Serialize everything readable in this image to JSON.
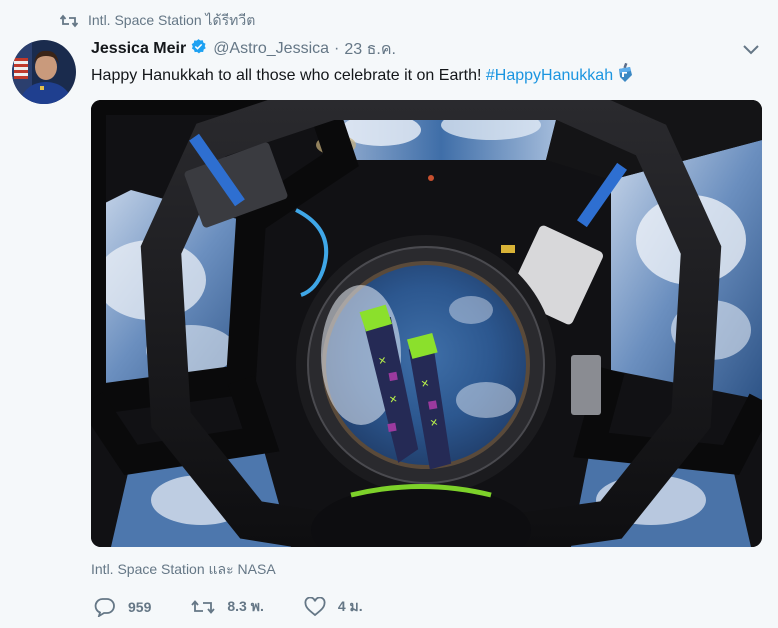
{
  "retweet": {
    "icon": "retweet-icon",
    "text": "Intl. Space Station ได้รีทวีต"
  },
  "author": {
    "display_name": "Jessica Meir",
    "handle": "@Astro_Jessica",
    "separator": "·",
    "time": "23 ธ.ค.",
    "verified": true
  },
  "tweet": {
    "text": "Happy Hanukkah to all those who celebrate it on Earth! ",
    "hashtag": "#HappyHanukkah",
    "emoji": "dreidel-emoji"
  },
  "media": {
    "description_icon": "photo"
  },
  "tagged": "Intl. Space Station และ NASA",
  "actions": {
    "reply_count": "959",
    "retweet_count": "8.3 พ.",
    "like_count": "4 ม."
  },
  "colors": {
    "link": "#1b95e0",
    "muted": "#657786",
    "background": "#f5f8fa"
  }
}
